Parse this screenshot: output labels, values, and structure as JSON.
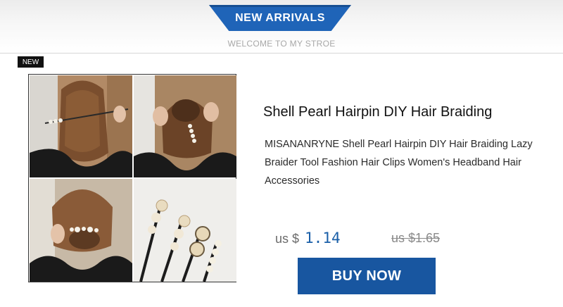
{
  "header": {
    "banner_label": "NEW ARRIVALS",
    "welcome_text": "WELCOME TO MY STROE"
  },
  "badge": {
    "label": "NEW"
  },
  "product": {
    "title": "Shell Pearl Hairpin DIY Hair Braiding",
    "description": "MISANANRYNE Shell Pearl Hairpin DIY Hair Braiding Lazy Braider Tool Fashion Hair Clips Women's Headband Hair Accessories",
    "price_currency": "us $",
    "price_value": "1.14",
    "old_price": "us $1.65",
    "buy_label": "BUY NOW"
  },
  "colors": {
    "banner": "#1f64b8",
    "buy_button": "#1856a0",
    "price": "#1a5fa8"
  }
}
